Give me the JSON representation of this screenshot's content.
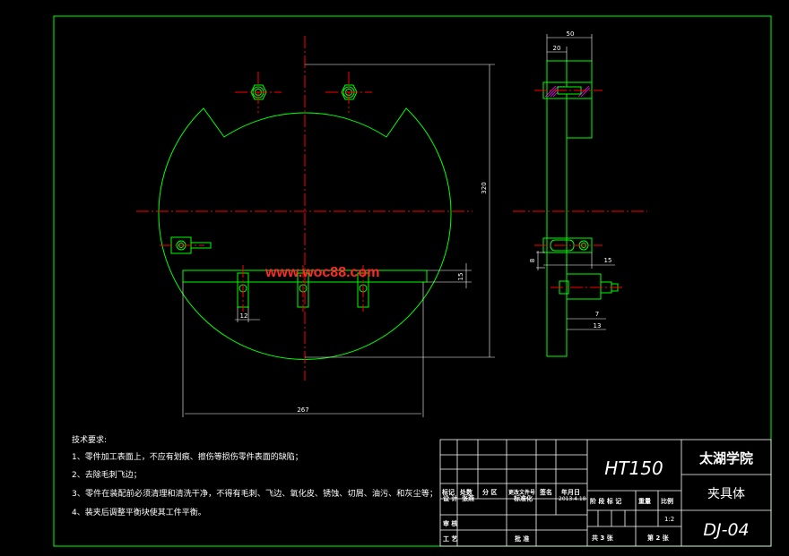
{
  "colors": {
    "background": "#000000",
    "outline": "#00ff00",
    "centerline": "#ff0000",
    "dimension": "#ffffff",
    "section_hatch": "#ff00ff",
    "watermark": "#ff2a2a"
  },
  "watermark": "www.woc88.com",
  "dimensions": {
    "height_320": "320",
    "width_267": "267",
    "width_12": "12",
    "offset_15_main": "15",
    "side_width_50": "50",
    "side_width_20": "20",
    "side_15": "15",
    "side_8": "8",
    "side_7": "7",
    "side_13": "13"
  },
  "technical_requirements": {
    "title": "技术要求:",
    "items": [
      "1、零件加工表面上，不应有划痕、擦伤等损伤零件表面的缺陷；",
      "2、去除毛刺飞边；",
      "3、零件在装配前必须清理和清洗干净，不得有毛刺、飞边、氧化皮、锈蚀、切屑、油污、和灰尘等；",
      "4、装夹后调整平衡块使其工件平衡。"
    ]
  },
  "title_block": {
    "material": "HT150",
    "school": "太湖学院",
    "part_name": "夹具体",
    "drawing_number": "DJ-04",
    "revision_headers": [
      "标记",
      "处数",
      "分 区",
      "更改文件号",
      "签名",
      "年月日"
    ],
    "designer_label": "设 计",
    "designer_name": "张燕",
    "standardization_label": "标准化",
    "date": "2013.4.18",
    "stage_label": "阶 段 标 记",
    "weight_label": "重量",
    "scale_label": "比例",
    "scale_value": "1:2",
    "review_label": "审 核",
    "process_label": "工 艺",
    "approve_label": "批 准",
    "total_sheets": "共 3 张",
    "sheet_no": "第 2 张"
  }
}
